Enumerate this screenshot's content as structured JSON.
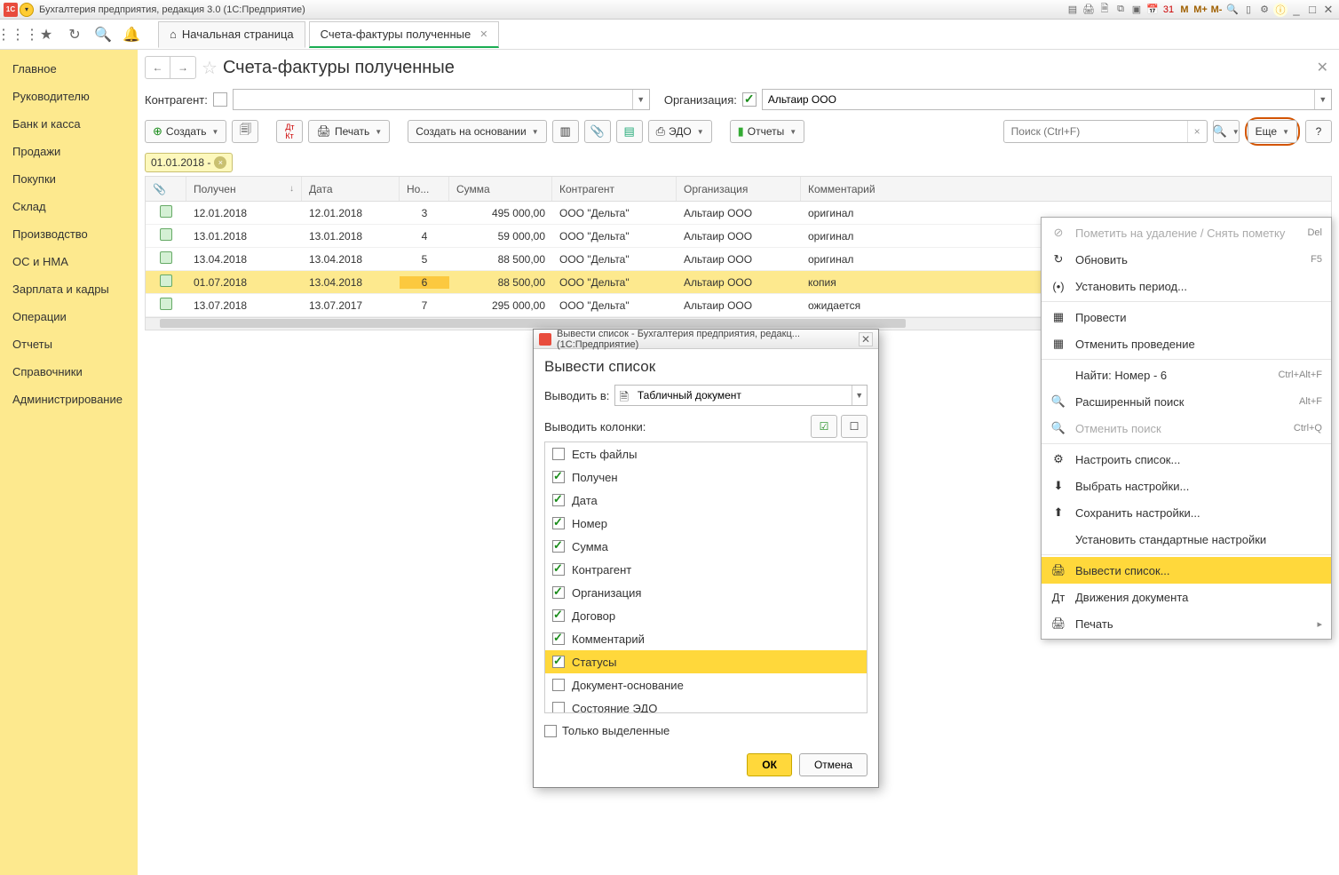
{
  "titlebar": {
    "title": "Бухгалтерия предприятия, редакция 3.0  (1С:Предприятие)",
    "m1": "M",
    "m2": "M+",
    "m3": "M-"
  },
  "tabs": {
    "home": "Начальная страница",
    "active": "Счета-фактуры полученные"
  },
  "nav": [
    "Главное",
    "Руководителю",
    "Банк и касса",
    "Продажи",
    "Покупки",
    "Склад",
    "Производство",
    "ОС и НМА",
    "Зарплата и кадры",
    "Операции",
    "Отчеты",
    "Справочники",
    "Администрирование"
  ],
  "page": {
    "title": "Счета-фактуры полученные"
  },
  "filter": {
    "counterparty_label": "Контрагент:",
    "org_label": "Организация:",
    "org_value": "Альтаир ООО"
  },
  "toolbar": {
    "create": "Создать",
    "print": "Печать",
    "create_based": "Создать на основании",
    "edo": "ЭДО",
    "reports": "Отчеты",
    "search_placeholder": "Поиск (Ctrl+F)",
    "more": "Еще"
  },
  "datechip": "01.01.2018 -",
  "columns": {
    "received": "Получен",
    "date": "Дата",
    "num": "Но...",
    "sum": "Сумма",
    "ka": "Контрагент",
    "org": "Организация",
    "comment": "Комментарий"
  },
  "rows": [
    {
      "received": "12.01.2018",
      "date": "12.01.2018",
      "num": "3",
      "sum": "495 000,00",
      "ka": "ООО \"Дельта\"",
      "org": "Альтаир ООО",
      "comment": "оригинал"
    },
    {
      "received": "13.01.2018",
      "date": "13.01.2018",
      "num": "4",
      "sum": "59 000,00",
      "ka": "ООО \"Дельта\"",
      "org": "Альтаир ООО",
      "comment": "оригинал"
    },
    {
      "received": "13.04.2018",
      "date": "13.04.2018",
      "num": "5",
      "sum": "88 500,00",
      "ka": "ООО \"Дельта\"",
      "org": "Альтаир ООО",
      "comment": "оригинал"
    },
    {
      "received": "01.07.2018",
      "date": "13.04.2018",
      "num": "6",
      "sum": "88 500,00",
      "ka": "ООО \"Дельта\"",
      "org": "Альтаир ООО",
      "comment": "копия",
      "sel": true
    },
    {
      "received": "13.07.2018",
      "date": "13.07.2017",
      "num": "7",
      "sum": "295 000,00",
      "ka": "ООО \"Дельта\"",
      "org": "Альтаир ООО",
      "comment": "ожидается"
    }
  ],
  "menu": {
    "items": [
      {
        "icon": "⊘",
        "label": "Пометить на удаление / Снять пометку",
        "sc": "Del",
        "disabled": true
      },
      {
        "icon": "↻",
        "label": "Обновить",
        "sc": "F5"
      },
      {
        "icon": "(•)",
        "label": "Установить период..."
      },
      {
        "sep": true
      },
      {
        "icon": "▦",
        "label": "Провести"
      },
      {
        "icon": "▦",
        "label": "Отменить проведение"
      },
      {
        "sep": true
      },
      {
        "icon": "",
        "label": "Найти: Номер - 6",
        "sc": "Ctrl+Alt+F"
      },
      {
        "icon": "🔍",
        "label": "Расширенный поиск",
        "sc": "Alt+F"
      },
      {
        "icon": "🔍",
        "label": "Отменить поиск",
        "sc": "Ctrl+Q",
        "disabled": true
      },
      {
        "sep": true
      },
      {
        "icon": "⚙",
        "label": "Настроить список..."
      },
      {
        "icon": "⬇",
        "label": "Выбрать настройки..."
      },
      {
        "icon": "⬆",
        "label": "Сохранить настройки..."
      },
      {
        "icon": "",
        "label": "Установить стандартные настройки"
      },
      {
        "sep": true
      },
      {
        "icon": "🖨",
        "label": "Вывести список...",
        "hl": true,
        "circ": true
      },
      {
        "icon": "Дт",
        "label": "Движения документа"
      },
      {
        "icon": "🖨",
        "label": "Печать",
        "sub": true
      }
    ]
  },
  "dialog": {
    "wintitle": "Вывести список - Бухгалтерия предприятия, редакц...  (1С:Предприятие)",
    "title": "Вывести список",
    "output_label": "Выводить в:",
    "output_value": "Табличный документ",
    "cols_label": "Выводить колонки:",
    "cols": [
      {
        "label": "Есть файлы",
        "on": false
      },
      {
        "label": "Получен",
        "on": true
      },
      {
        "label": "Дата",
        "on": true
      },
      {
        "label": "Номер",
        "on": true
      },
      {
        "label": "Сумма",
        "on": true
      },
      {
        "label": "Контрагент",
        "on": true
      },
      {
        "label": "Организация",
        "on": true
      },
      {
        "label": "Договор",
        "on": true
      },
      {
        "label": "Комментарий",
        "on": true
      },
      {
        "label": "Статусы",
        "on": true,
        "hl": true
      },
      {
        "label": "Документ-основание",
        "on": false
      },
      {
        "label": "Состояние ЭДО",
        "on": false
      }
    ],
    "only_selected": "Только выделенные",
    "ok": "ОК",
    "cancel": "Отмена"
  }
}
